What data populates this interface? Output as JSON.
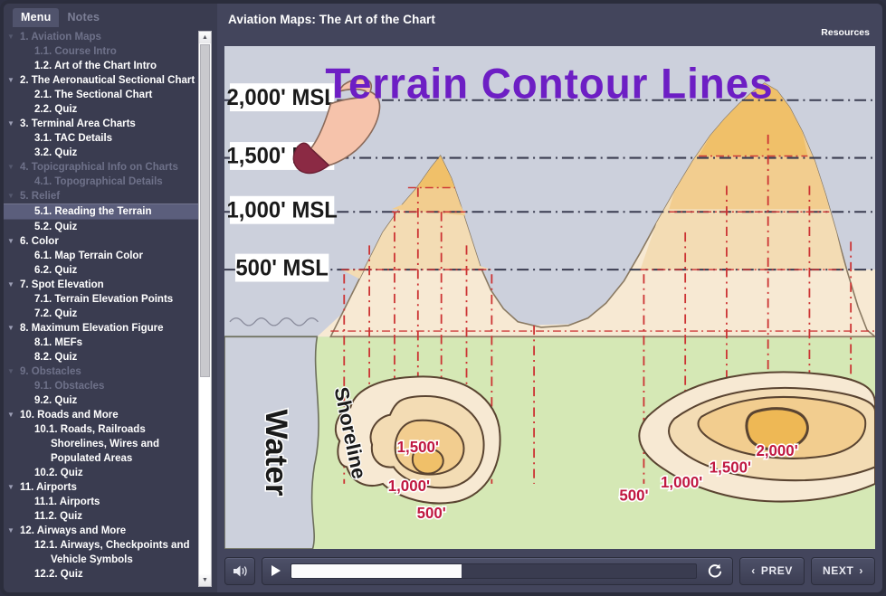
{
  "sidebar": {
    "tabs": [
      {
        "label": "Menu",
        "active": true
      },
      {
        "label": "Notes",
        "active": false
      }
    ],
    "items": [
      {
        "label": "1. Aviation Maps",
        "level": 1,
        "arrow": "▼",
        "dim": true,
        "selected": false
      },
      {
        "label": "1.1. Course Intro",
        "level": 2,
        "arrow": "",
        "dim": true,
        "selected": false
      },
      {
        "label": "1.2. Art of the Chart Intro",
        "level": 2,
        "arrow": "",
        "dim": false,
        "selected": false
      },
      {
        "label": "2. The Aeronautical Sectional Chart",
        "level": 1,
        "arrow": "▼",
        "dim": false,
        "selected": false
      },
      {
        "label": "2.1. The Sectional Chart",
        "level": 2,
        "arrow": "",
        "dim": false,
        "selected": false
      },
      {
        "label": "2.2. Quiz",
        "level": 2,
        "arrow": "",
        "dim": false,
        "selected": false
      },
      {
        "label": "3. Terminal Area Charts",
        "level": 1,
        "arrow": "▼",
        "dim": false,
        "selected": false
      },
      {
        "label": "3.1. TAC Details",
        "level": 2,
        "arrow": "",
        "dim": false,
        "selected": false
      },
      {
        "label": "3.2. Quiz",
        "level": 2,
        "arrow": "",
        "dim": false,
        "selected": false
      },
      {
        "label": "4. Topicgraphical Info on Charts",
        "level": 1,
        "arrow": "▼",
        "dim": true,
        "selected": false
      },
      {
        "label": "4.1. Topographical Details",
        "level": 2,
        "arrow": "",
        "dim": true,
        "selected": false
      },
      {
        "label": "5. Relief",
        "level": 1,
        "arrow": "▼",
        "dim": true,
        "selected": false
      },
      {
        "label": "5.1. Reading the Terrain",
        "level": 2,
        "arrow": "",
        "dim": false,
        "selected": true
      },
      {
        "label": "5.2. Quiz",
        "level": 2,
        "arrow": "",
        "dim": false,
        "selected": false
      },
      {
        "label": "6. Color",
        "level": 1,
        "arrow": "▼",
        "dim": false,
        "selected": false
      },
      {
        "label": "6.1. Map Terrain Color",
        "level": 2,
        "arrow": "",
        "dim": false,
        "selected": false
      },
      {
        "label": "6.2. Quiz",
        "level": 2,
        "arrow": "",
        "dim": false,
        "selected": false
      },
      {
        "label": "7. Spot Elevation",
        "level": 1,
        "arrow": "▼",
        "dim": false,
        "selected": false
      },
      {
        "label": "7.1. Terrain Elevation Points",
        "level": 2,
        "arrow": "",
        "dim": false,
        "selected": false
      },
      {
        "label": "7.2. Quiz",
        "level": 2,
        "arrow": "",
        "dim": false,
        "selected": false
      },
      {
        "label": "8. Maximum Elevation Figure",
        "level": 1,
        "arrow": "▼",
        "dim": false,
        "selected": false
      },
      {
        "label": "8.1. MEFs",
        "level": 2,
        "arrow": "",
        "dim": false,
        "selected": false
      },
      {
        "label": "8.2. Quiz",
        "level": 2,
        "arrow": "",
        "dim": false,
        "selected": false
      },
      {
        "label": "9. Obstacles",
        "level": 1,
        "arrow": "▼",
        "dim": true,
        "selected": false
      },
      {
        "label": "9.1. Obstacles",
        "level": 2,
        "arrow": "",
        "dim": true,
        "selected": false
      },
      {
        "label": "9.2. Quiz",
        "level": 2,
        "arrow": "",
        "dim": false,
        "selected": false
      },
      {
        "label": "10. Roads and More",
        "level": 1,
        "arrow": "▼",
        "dim": false,
        "selected": false
      },
      {
        "label": "10.1. Roads, Railroads Shorelines, Wires and Populated Areas",
        "level": 2,
        "arrow": "",
        "dim": false,
        "selected": false
      },
      {
        "label": "10.2. Quiz",
        "level": 2,
        "arrow": "",
        "dim": false,
        "selected": false
      },
      {
        "label": "11. Airports",
        "level": 1,
        "arrow": "▼",
        "dim": false,
        "selected": false
      },
      {
        "label": "11.1. Airports",
        "level": 2,
        "arrow": "",
        "dim": false,
        "selected": false
      },
      {
        "label": "11.2. Quiz",
        "level": 2,
        "arrow": "",
        "dim": false,
        "selected": false
      },
      {
        "label": "12. Airways and More",
        "level": 1,
        "arrow": "▼",
        "dim": false,
        "selected": false
      },
      {
        "label": "12.1. Airways, Checkpoints and Vehicle Symbols",
        "level": 2,
        "arrow": "",
        "dim": false,
        "selected": false
      },
      {
        "label": "12.2. Quiz",
        "level": 2,
        "arrow": "",
        "dim": false,
        "selected": false
      }
    ],
    "scrollbar": {
      "up_glyph": "▲",
      "down_glyph": "▼"
    }
  },
  "header": {
    "course_title": "Aviation Maps: The Art of the Chart",
    "resources_label": "Resources"
  },
  "slide": {
    "title": "Terrain Contour Lines",
    "elevation_labels": [
      "2,000' MSL",
      "1,500' MSL",
      "1,000' MSL",
      "500' MSL"
    ],
    "region_labels": [
      "Water",
      "Shoreline"
    ],
    "contour_labels_left_hill": [
      "1,500'",
      "1,000'",
      "500'"
    ],
    "contour_labels_right_hill": [
      "2,000'",
      "1,500'",
      "1,000'",
      "500'"
    ],
    "colors": {
      "title_purple": "#6d1ec4",
      "sky_gray": "#ccd0dc",
      "terrain_land_green": "#d5e8b5",
      "contour_fill_1": "#f7e9d3",
      "contour_fill_2": "#f3dcb4",
      "contour_fill_3": "#f2cd8f",
      "contour_fill_4": "#f0c069",
      "contour_line": "#5a4431",
      "dashline_red": "#cc3333",
      "label_red": "#c01841",
      "skin": "#f3bca4"
    }
  },
  "player": {
    "volume_icon": "speaker-icon",
    "play_icon": "play-icon",
    "replay_icon": "replay-icon",
    "progress_percent": 42,
    "prev_label": "PREV",
    "next_label": "NEXT",
    "prev_chevron": "‹",
    "next_chevron": "›"
  }
}
